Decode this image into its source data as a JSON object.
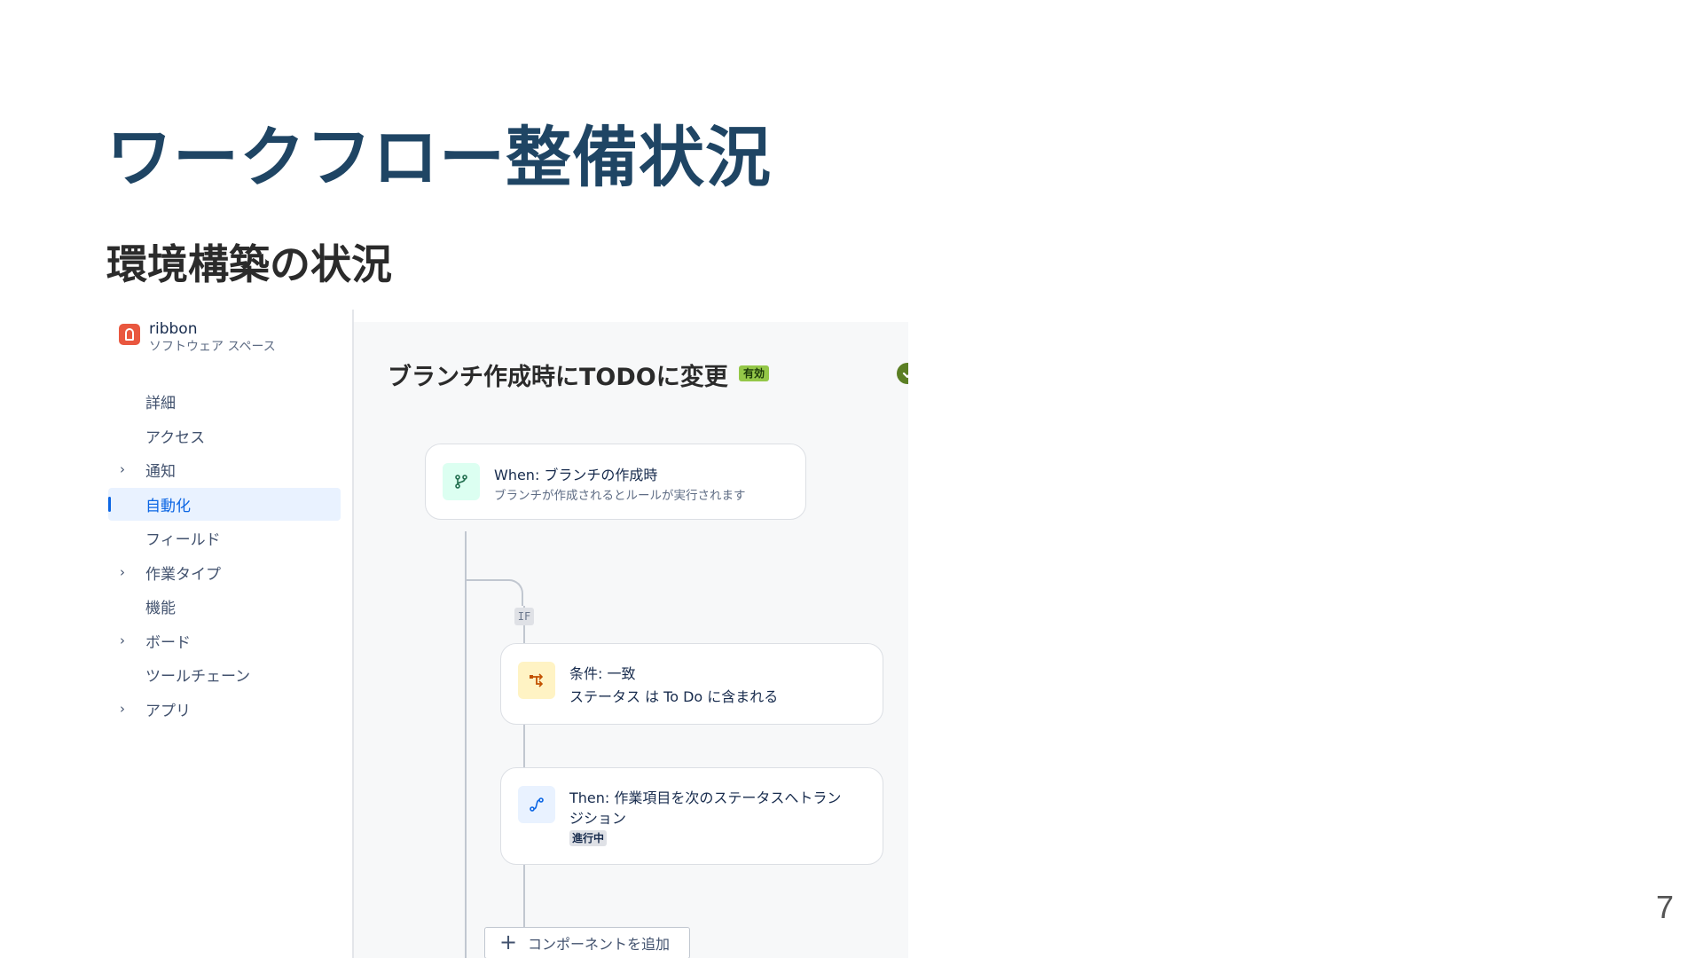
{
  "slide": {
    "title": "ワークフロー整備状況",
    "subtitle": "環境構築の状況",
    "page_number": "7"
  },
  "brand": {
    "name": "ribbon",
    "space": "ソフトウェア スペース",
    "logo_color": "#e9573f"
  },
  "sidebar": {
    "items": [
      {
        "label": "詳細",
        "expandable": false,
        "active": false
      },
      {
        "label": "アクセス",
        "expandable": false,
        "active": false
      },
      {
        "label": "通知",
        "expandable": true,
        "active": false
      },
      {
        "label": "自動化",
        "expandable": false,
        "active": true
      },
      {
        "label": "フィールド",
        "expandable": false,
        "active": false
      },
      {
        "label": "作業タイプ",
        "expandable": true,
        "active": false
      },
      {
        "label": "機能",
        "expandable": false,
        "active": false
      },
      {
        "label": "ボード",
        "expandable": true,
        "active": false
      },
      {
        "label": "ツールチェーン",
        "expandable": false,
        "active": false
      },
      {
        "label": "アプリ",
        "expandable": true,
        "active": false
      }
    ]
  },
  "rule": {
    "title": "ブランチ作成時にTODOに変更",
    "status_badge": "有効",
    "toggle_on": true
  },
  "flow": {
    "trigger": {
      "title": "When: ブランチの作成時",
      "description": "ブランチが作成されるとルールが実行されます",
      "icon": "branch-icon"
    },
    "if_label": "IF",
    "condition": {
      "title": "条件: 一致",
      "description": "ステータス は To Do に含まれる",
      "icon": "condition-icon"
    },
    "action": {
      "title_line1": "Then: 作業項目を次のステータスへトラン",
      "title_line2": "ジション",
      "status": "進行中",
      "icon": "transition-icon"
    },
    "add_component": "コンポーネントを追加"
  },
  "colors": {
    "title": "#1f4564",
    "accent": "#0c66e4",
    "active_bg": "#e9f2ff",
    "enabled_badge": "#94c748",
    "toggle": "#5b7f24"
  }
}
